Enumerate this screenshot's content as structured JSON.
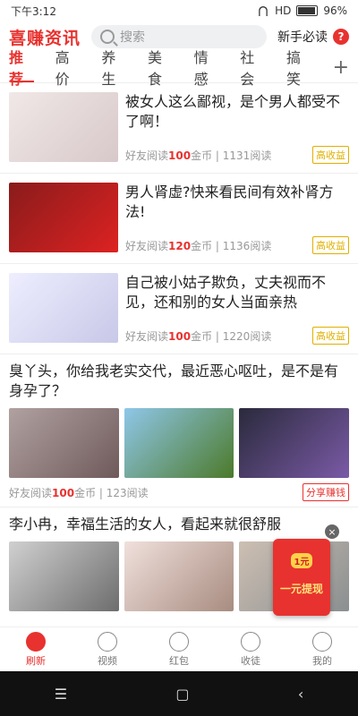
{
  "status": {
    "time": "下午3:12",
    "network": "HD",
    "battery": "96%"
  },
  "header": {
    "logo": "喜赚资讯",
    "search_placeholder": "搜索",
    "newbie_label": "新手必读",
    "help_label": "?"
  },
  "tabs": [
    "推荐",
    "高价",
    "养生",
    "美食",
    "情感",
    "社会",
    "搞笑"
  ],
  "tab_plus": "+",
  "feed": {
    "items": [
      {
        "title": "被女人这么鄙视，是个男人都受不了啊！",
        "reader": "好友阅读",
        "coins": "100",
        "coin_unit": "金币",
        "reads": "| 1131阅读",
        "badge": "高收益"
      },
      {
        "title": "男人肾虚?快来看民间有效补肾方法!",
        "reader": "好友阅读",
        "coins": "120",
        "coin_unit": "金币",
        "reads": "| 1136阅读",
        "badge": "高收益"
      },
      {
        "title": "自己被小姑子欺负，丈夫视而不见，还和别的女人当面亲热",
        "reader": "好友阅读",
        "coins": "100",
        "coin_unit": "金币",
        "reads": "| 1220阅读",
        "badge": "高收益"
      }
    ],
    "big1": {
      "title": "臭丫头，你给我老实交代，最近恶心呕吐，是不是有身孕了？",
      "reader": "好友阅读",
      "coins": "100",
      "coin_unit": "金币",
      "reads": "| 123阅读",
      "badge": "分享赚钱"
    },
    "big2": {
      "title": "李小冉，幸福生活的女人，看起来就很舒服"
    }
  },
  "popup": {
    "close": "×",
    "amount": "1元",
    "label": "一元提现"
  },
  "bottom_nav": [
    {
      "label": "刷新"
    },
    {
      "label": "视频"
    },
    {
      "label": "红包"
    },
    {
      "label": "收徒"
    },
    {
      "label": "我的"
    }
  ],
  "system_nav": {
    "menu": "☰",
    "home": "▢",
    "back": "‹"
  }
}
